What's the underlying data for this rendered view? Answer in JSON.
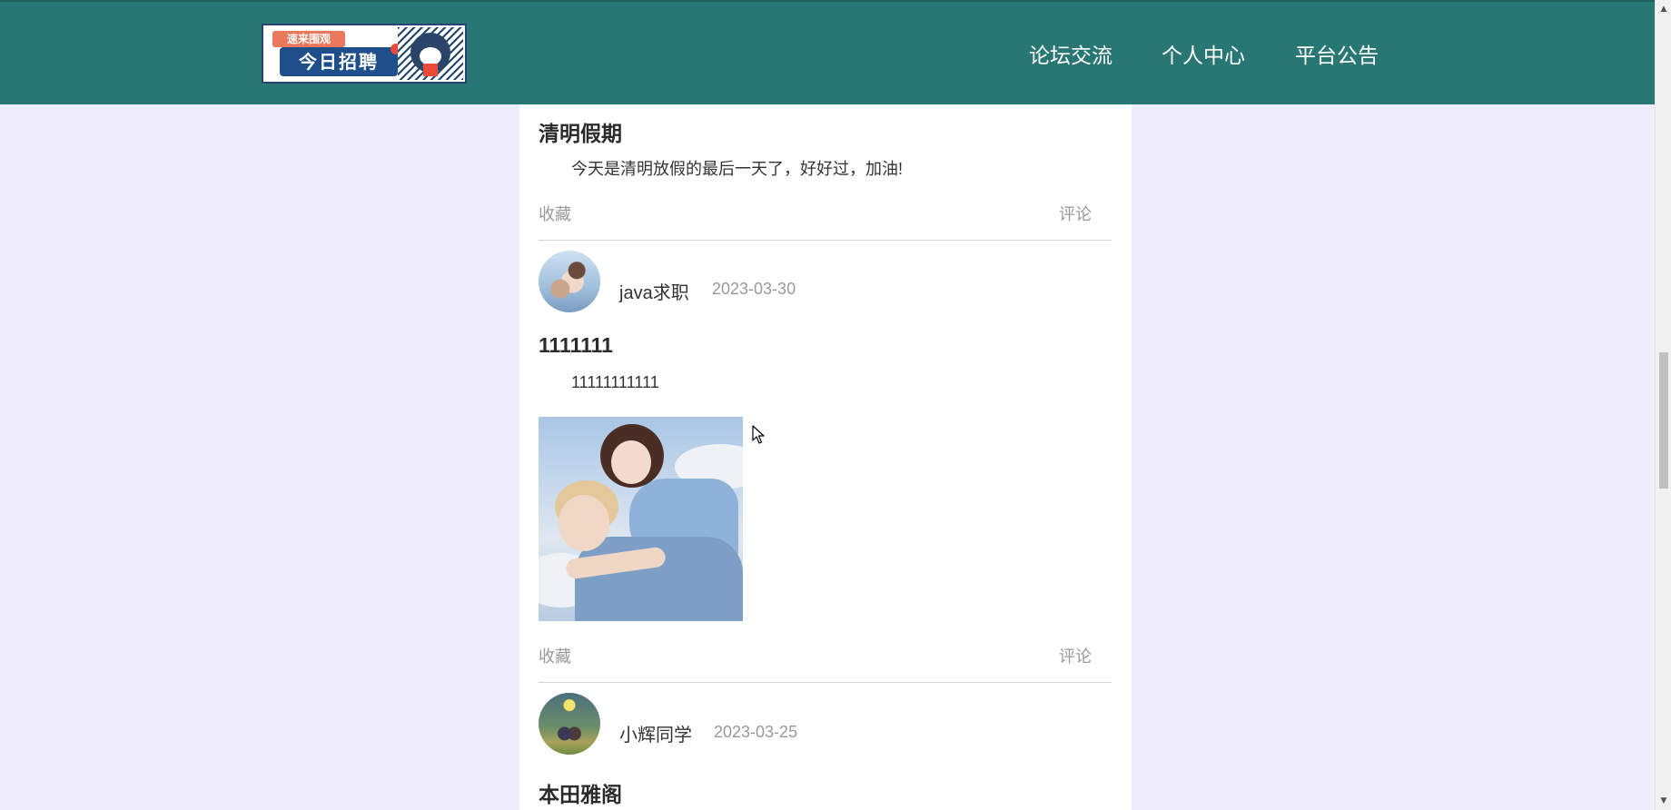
{
  "header": {
    "logo_tag": "速来围观",
    "logo_main": "今日招聘",
    "nav": [
      {
        "label": "论坛交流"
      },
      {
        "label": "个人中心"
      },
      {
        "label": "平台公告"
      }
    ]
  },
  "posts": [
    {
      "title": "清明假期",
      "body": "今天是清明放假的最后一天了，好好过，加油!",
      "favorite_label": "收藏",
      "comment_label": "评论"
    },
    {
      "username": "java求职",
      "date": "2023-03-30",
      "title": "1111111",
      "body": "11111111111",
      "favorite_label": "收藏",
      "comment_label": "评论"
    },
    {
      "username": "小辉同学",
      "date": "2023-03-25",
      "title": "本田雅阁"
    }
  ],
  "colors": {
    "header_bg": "#297774",
    "page_bg": "#eeecfd",
    "card_bg": "#ffffff"
  }
}
